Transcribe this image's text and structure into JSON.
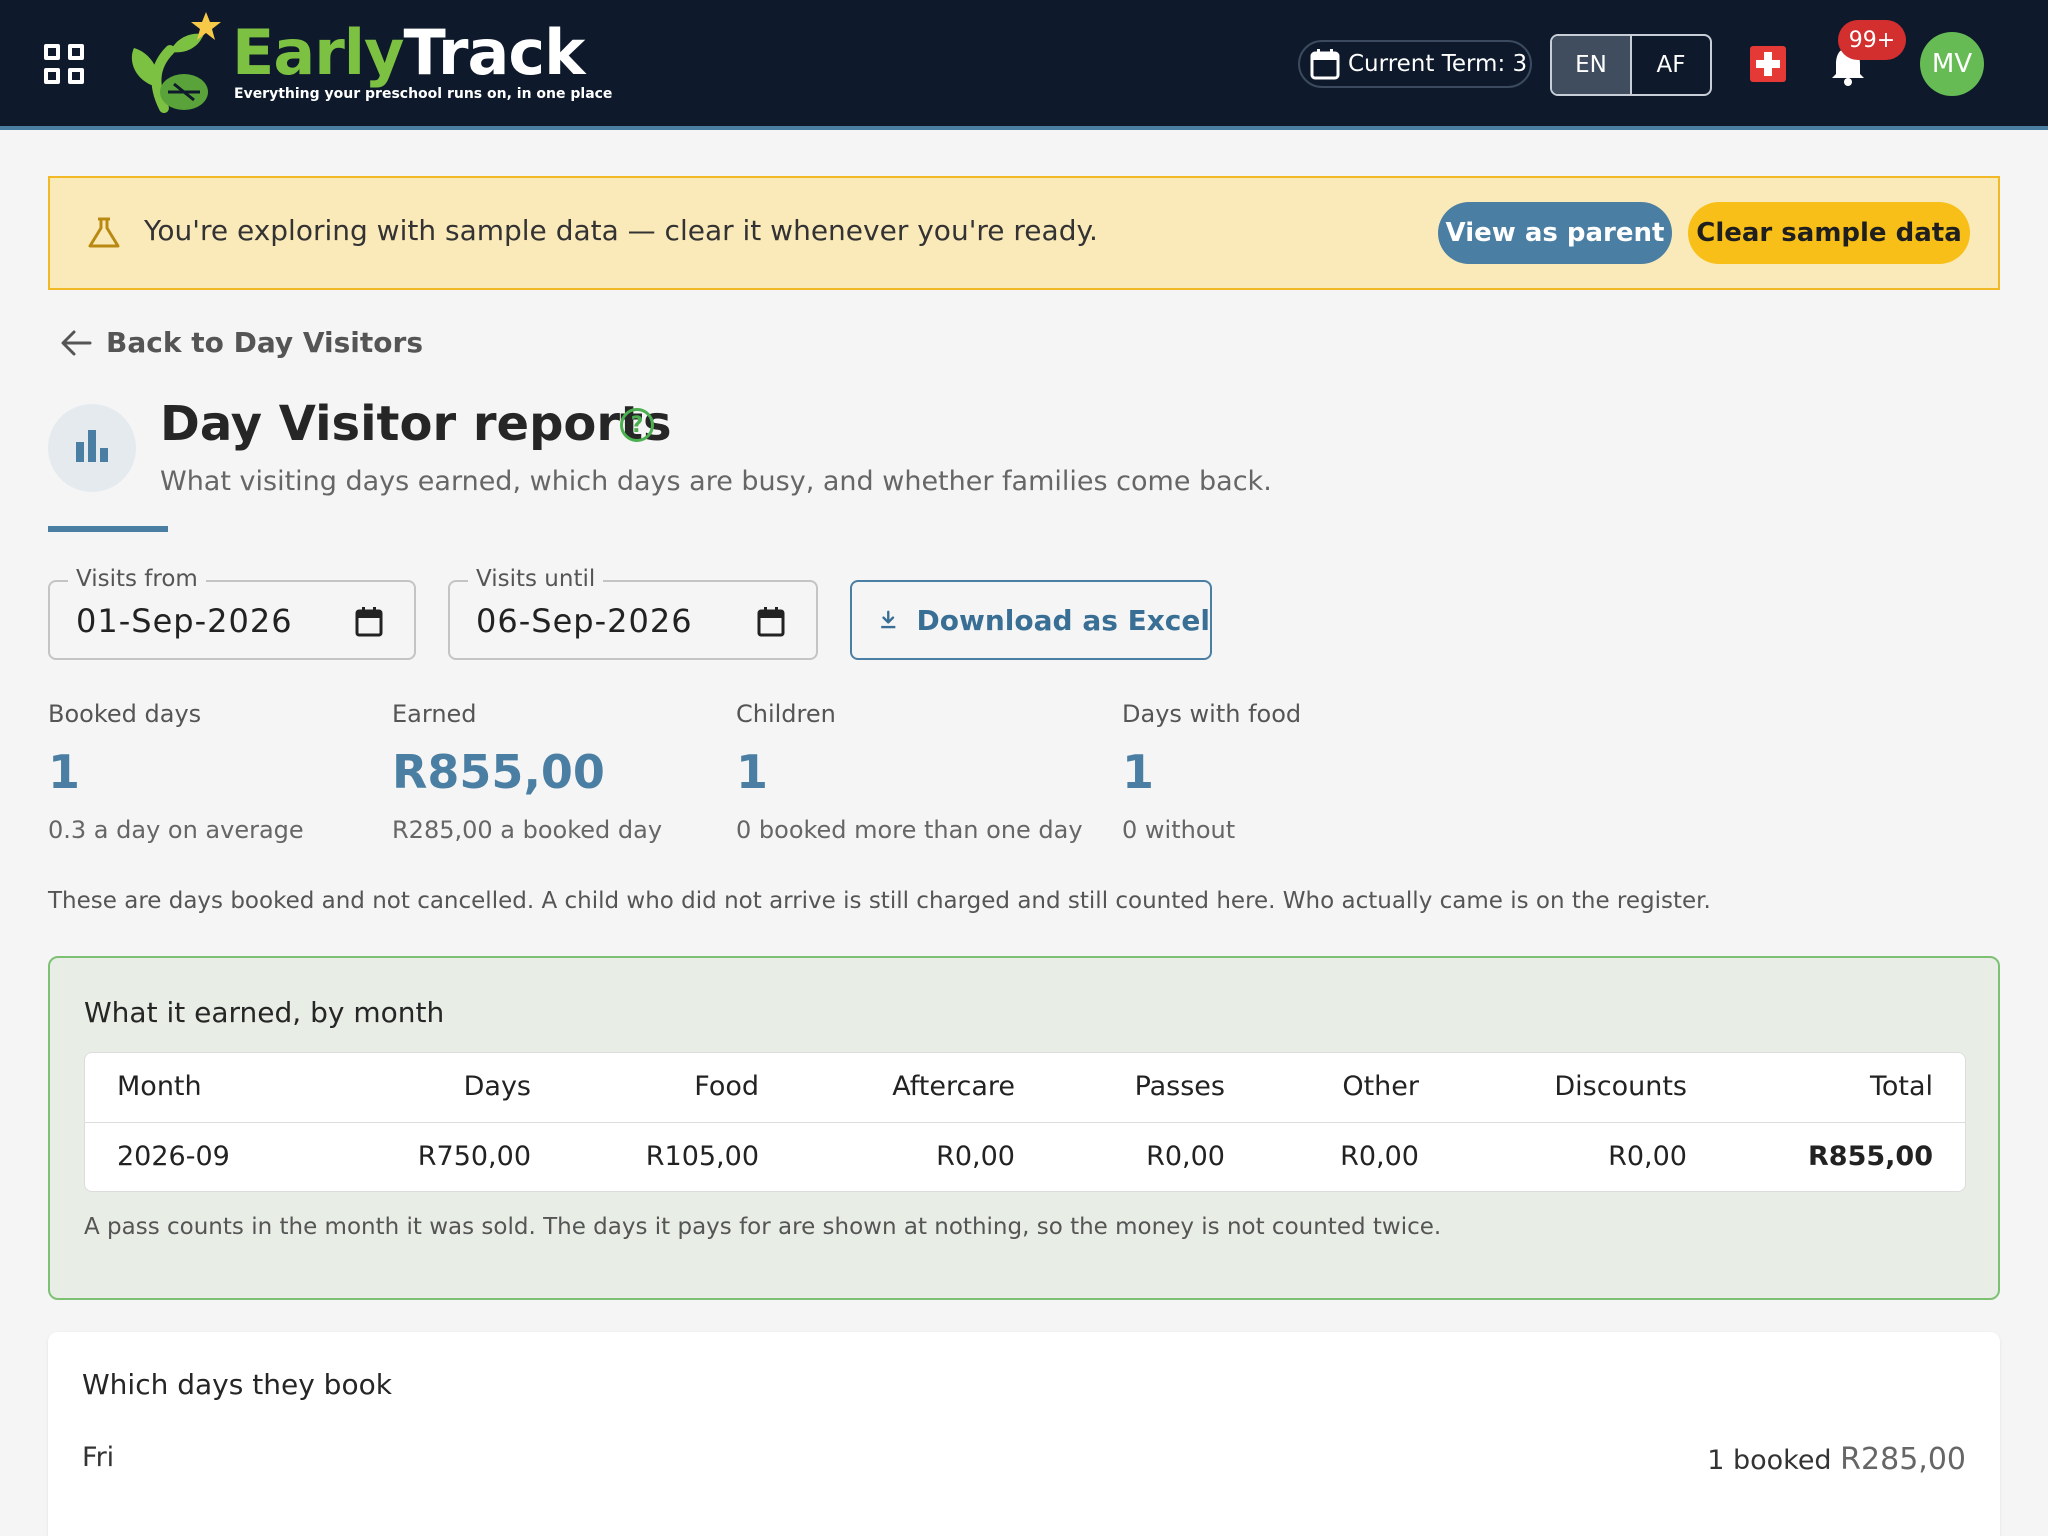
{
  "app": {
    "name_a": "Early",
    "name_b": "Track",
    "tagline": "Everything your preschool runs on, in one place"
  },
  "header": {
    "term": "Current Term: 3",
    "lang_en": "EN",
    "lang_af": "AF",
    "notifications": "99+",
    "avatar": "MV"
  },
  "banner": {
    "text": "You're exploring with sample data — clear it whenever you're ready.",
    "view_parent": "View as parent",
    "clear": "Clear sample data"
  },
  "back": "Back to Day Visitors",
  "page": {
    "title": "Day Visitor reports",
    "help": "?",
    "subtitle": "What visiting days earned, which days are busy, and whether families come back."
  },
  "filters": {
    "from_label": "Visits from",
    "from_value": "01-Sep-2026",
    "until_label": "Visits until",
    "until_value": "06-Sep-2026",
    "download": "Download as Excel"
  },
  "stats": [
    {
      "label": "Booked days",
      "value": "1",
      "sub": "0.3 a day on average"
    },
    {
      "label": "Earned",
      "value": "R855,00",
      "sub": "R285,00 a booked day"
    },
    {
      "label": "Children",
      "value": "1",
      "sub": "0 booked more than one day"
    },
    {
      "label": "Days with food",
      "value": "1",
      "sub": "0 without"
    }
  ],
  "note": "These are days booked and not cancelled. A child who did not arrive is still charged and still counted here. Who actually came is on the register.",
  "earned": {
    "title": "What it earned, by month",
    "columns": [
      "Month",
      "Days",
      "Food",
      "Aftercare",
      "Passes",
      "Other",
      "Discounts",
      "Total"
    ],
    "rows": [
      [
        "2026-09",
        "R750,00",
        "R105,00",
        "R0,00",
        "R0,00",
        "R0,00",
        "R0,00",
        "R855,00"
      ]
    ],
    "footnote": "A pass counts in the month it was sold. The days it pays for are shown at nothing, so the money is not counted twice."
  },
  "days": {
    "title": "Which days they book",
    "items": [
      {
        "day": "Fri",
        "booked": "1 booked",
        "amount": "R285,00"
      }
    ]
  },
  "colors": {
    "navy": "#0e1a2b",
    "accent": "#4a7fa3",
    "green": "#7dc142",
    "yellow": "#f7bf17"
  }
}
